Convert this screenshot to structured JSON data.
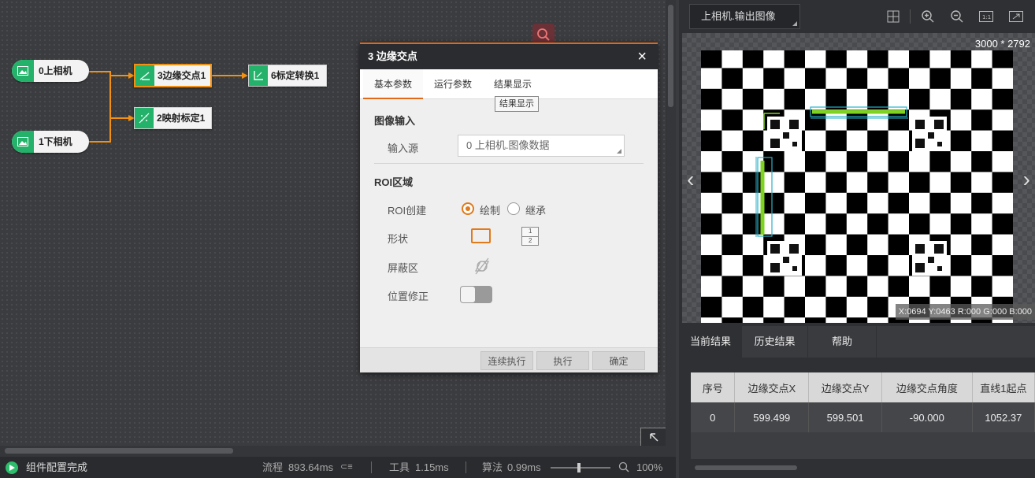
{
  "flow": {
    "nodes": {
      "cam0": "0上相机",
      "cam1": "1下相机",
      "edge": "3边缘交点1",
      "map": "2映射标定1",
      "calib": "6标定转换1"
    }
  },
  "dialog": {
    "title": "3 边缘交点",
    "close": "×",
    "tabs": [
      "基本参数",
      "运行参数",
      "结果显示"
    ],
    "tooltip": "结果显示",
    "image_input": {
      "header": "图像输入",
      "source_label": "输入源",
      "source_value": "0 上相机.图像数据"
    },
    "roi": {
      "header": "ROI区域",
      "create_label": "ROI创建",
      "option_draw": "绘制",
      "option_inherit": "继承",
      "shape_label": "形状",
      "mask_label": "屏蔽区",
      "pos_fix_label": "位置修正",
      "shape_icon_text_1": "1",
      "shape_icon_text_2": "2"
    },
    "buttons": {
      "continuous": "连续执行",
      "execute": "执行",
      "confirm": "确定"
    }
  },
  "viewer": {
    "image_select": "上相机.输出图像",
    "image_size": "3000 * 2792",
    "pixel_info": "X:0694  Y:0463  R:000  G:000  B:000",
    "nav_prev": "‹",
    "nav_next": "›"
  },
  "results": {
    "tabs": [
      "当前结果",
      "历史结果",
      "帮助"
    ],
    "columns": [
      "序号",
      "边缘交点X",
      "边缘交点Y",
      "边缘交点角度",
      "直线1起点"
    ],
    "rows": [
      [
        "0",
        "599.499",
        "599.501",
        "-90.000",
        "1052.37"
      ]
    ]
  },
  "status": {
    "message": "组件配置完成",
    "flow_label": "流程",
    "flow_time": "893.64ms",
    "tool_label": "工具",
    "tool_time": "1.15ms",
    "algo_label": "算法",
    "algo_time": "0.99ms",
    "zoom": "100%"
  },
  "colors": {
    "accent": "#e06a1a",
    "node_green": "#24b26a",
    "connector": "#f29111",
    "roi_line": "#7ed321"
  }
}
